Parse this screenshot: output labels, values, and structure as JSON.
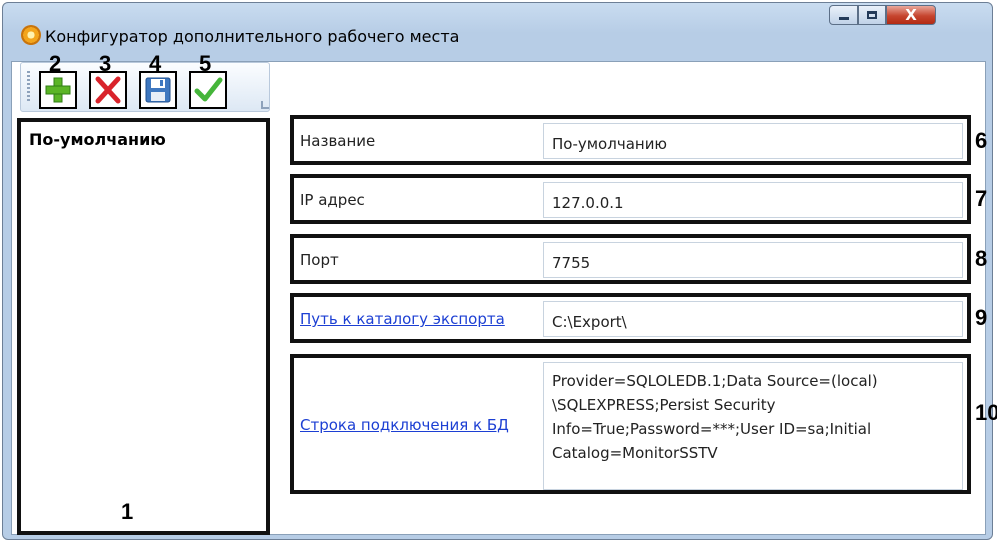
{
  "window": {
    "title": "Конфигуратор дополнительного рабочего места",
    "close_glyph": "X"
  },
  "toolbar": {
    "buttons": [
      {
        "number": "2",
        "icon": "add-icon",
        "color": "#5bb526"
      },
      {
        "number": "3",
        "icon": "delete-icon",
        "color": "#d9232b"
      },
      {
        "number": "4",
        "icon": "save-icon",
        "color": "#3f78c0"
      },
      {
        "number": "5",
        "icon": "apply-icon",
        "color": "#45b53a"
      }
    ]
  },
  "list": {
    "items": [
      "По-умолчанию"
    ],
    "annotation": "1"
  },
  "fields": [
    {
      "label": "Название",
      "value": "По-умолчанию",
      "annotation": "6"
    },
    {
      "label": "IP адрес",
      "value": "127.0.0.1",
      "annotation": "7"
    },
    {
      "label": "Порт",
      "value": "7755",
      "annotation": "8"
    },
    {
      "label": "Путь к каталогу экспорта",
      "value": "C:\\Export\\",
      "annotation": "9"
    },
    {
      "label": "Строка подключения к БД",
      "value": "Provider=SQLOLEDB.1;Data Source=(local)\n\\SQLEXPRESS;Persist Security\nInfo=True;Password=***;User ID=sa;Initial\nCatalog=MonitorSSTV",
      "annotation": "10"
    }
  ]
}
